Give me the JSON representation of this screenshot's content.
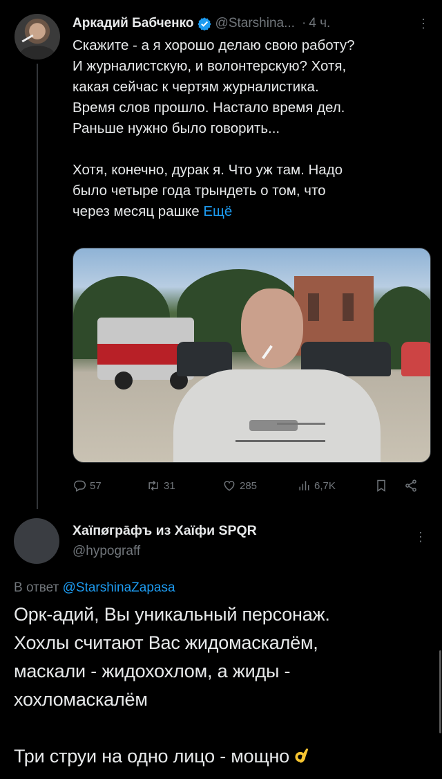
{
  "tweet": {
    "author": "Аркадий Бабченко",
    "handle": "@Starshina...",
    "separator": "·",
    "time": "4 ч.",
    "paragraph1": "Скажите - а я хорошо делаю свою работу?\nИ журналистскую, и волонтерскую? Хотя,\nкакая сейчас к чертям журналистика.\nВремя слов прошло. Настало время дел.\nРаньше нужно было говорить...",
    "paragraph2": "Хотя, конечно, дурак я. Что уж там. Надо\nбыло четыре года трындеть о том, что\nчерез месяц рашке",
    "more_link": "Ещё",
    "stats": {
      "replies": "57",
      "retweets": "31",
      "likes": "285",
      "views": "6,7K"
    }
  },
  "reply": {
    "author": "Хаїпøгра̄фъ из Хаїфи SPQR",
    "handle": "@hypograff",
    "reply_prefix": "В ответ",
    "reply_to": "@StarshinaZapasa",
    "paragraph1": "Орк-адий, Вы уникальный персонаж.\nХохлы считают Вас жидомаскалём,\nмаскали - жидохохлом, а жиды -\nхохломаскалём",
    "paragraph2": "Три струи на одно лицо - мощно"
  },
  "colors": {
    "background": "#000000",
    "text": "#e7e9ea",
    "muted": "#71767b",
    "accent": "#1d9bf0"
  },
  "icons": [
    "verified-badge-icon",
    "more-icon",
    "reply-icon",
    "retweet-icon",
    "like-icon",
    "views-icon",
    "bookmark-icon",
    "share-icon",
    "ok-hand-emoji-icon"
  ]
}
